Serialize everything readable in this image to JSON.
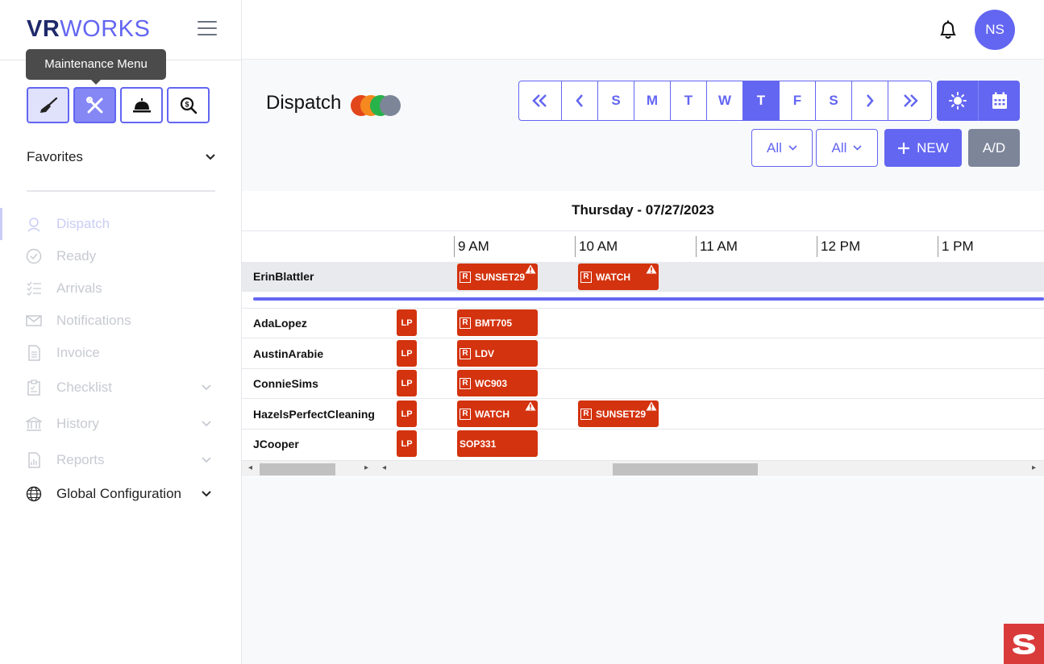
{
  "brand": {
    "logo_bold": "VR",
    "logo_light": "WORKS"
  },
  "tooltip": "Maintenance Menu",
  "sidebar": {
    "favorites_label": "Favorites",
    "items": [
      {
        "label": "Dispatch",
        "icon": "headset-icon"
      },
      {
        "label": "Ready",
        "icon": "check-circle-icon"
      },
      {
        "label": "Arrivals",
        "icon": "checklist-icon"
      },
      {
        "label": "Notifications",
        "icon": "envelope-icon"
      },
      {
        "label": "Invoice",
        "icon": "document-icon"
      },
      {
        "label": "Checklist",
        "icon": "clipboard-icon"
      },
      {
        "label": "History",
        "icon": "bank-icon"
      },
      {
        "label": "Reports",
        "icon": "report-icon"
      },
      {
        "label": "Global Configuration",
        "icon": "globe-icon"
      }
    ]
  },
  "user": {
    "initials": "NS"
  },
  "page": {
    "title": "Dispatch"
  },
  "status_dots": [
    "#e2461b",
    "#f5891f",
    "#27b24a",
    "#7d8599"
  ],
  "daynav": {
    "days": [
      "S",
      "M",
      "T",
      "W",
      "T",
      "F",
      "S"
    ],
    "selected_index": 4
  },
  "filters": {
    "first": "All",
    "second": "All"
  },
  "buttons": {
    "new": "NEW",
    "ad": "A/D"
  },
  "schedule": {
    "date": "Thursday - 07/27/2023",
    "hours": [
      "9 AM",
      "10 AM",
      "11 AM",
      "12 PM",
      "1 PM"
    ],
    "rows": [
      {
        "name": "ErinBlattler"
      },
      {
        "name": "AdaLopez"
      },
      {
        "name": "AustinArabie"
      },
      {
        "name": "ConnieSims"
      },
      {
        "name": "HazelsPerfectCleaning"
      },
      {
        "name": "JCooper"
      }
    ],
    "chips": {
      "lp": "LP",
      "r": "R",
      "erin_1": "SUNSET29",
      "erin_2": "WATCH",
      "ada": "BMT705",
      "austin": "LDV",
      "connie": "WC903",
      "hazel_1": "WATCH",
      "hazel_2": "SUNSET29",
      "jcooper": "SOP331"
    }
  },
  "colors": {
    "accent": "#6366f1",
    "chip": "#d3330e",
    "ad_button": "#7d8599"
  }
}
